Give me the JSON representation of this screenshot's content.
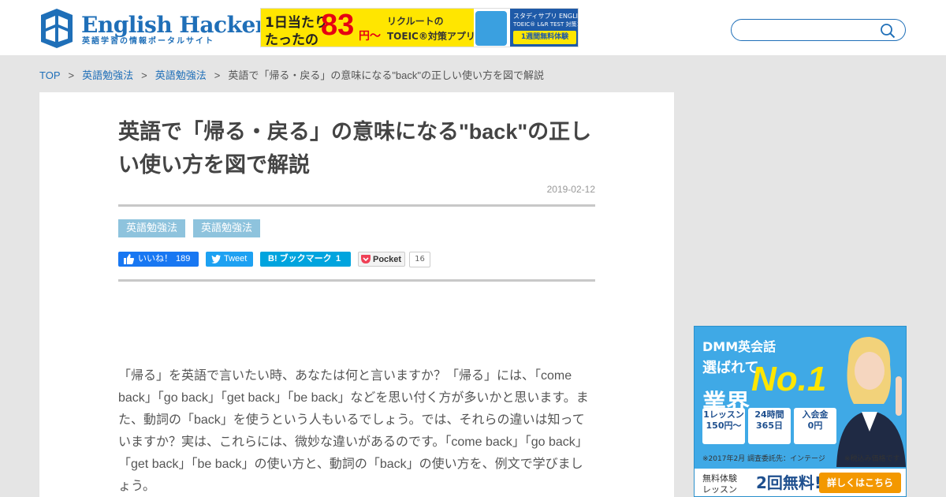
{
  "header": {
    "logo": {
      "title": "English Hacker",
      "subtitle": "英語学習の情報ポータルサイト"
    },
    "banner": {
      "line1": "1日当たり",
      "line2": "たったの",
      "price": "83",
      "yen": "円〜",
      "recruit": "リクルートの",
      "toeic": "TOEIC®対策アプリ",
      "brand": "スタディサプリ ENGLISH",
      "course": "TOEIC® L&R TEST 対策コース",
      "cta": "1週間無料体験"
    },
    "search": {
      "placeholder": ""
    }
  },
  "breadcrumb": {
    "items": [
      "TOP",
      "英語勉強法",
      "英語勉強法"
    ],
    "separator": ">",
    "current": "英語で「帰る・戻る」の意味になる\"back\"の正しい使い方を図で解説"
  },
  "article": {
    "title": "英語で「帰る・戻る」の意味になる\"back\"の正しい使い方を図で解説",
    "date": "2019-02-12",
    "tags": [
      "英語勉強法",
      "英語勉強法"
    ],
    "share": {
      "facebook_label": "いいね！",
      "facebook_count": "189",
      "twitter_label": "Tweet",
      "hatena_label": "B! ブックマーク",
      "hatena_count": "1",
      "pocket_label": "Pocket",
      "pocket_count": "16"
    },
    "body": "「帰る」を英語で言いたい時、あなたは何と言いますか？「帰る」には、「come back」「go back」「get back」「be back」などを思い付く方が多いかと思います。また、動詞の「back」を使うという人もいるでしょう。では、それらの違いは知っていますか？実は、これらには、微妙な違いがあるのです。「come back」「go back」「get back」「be back」の使い方と、動詞の「back」の使い方を、例文で学びましょう。"
  },
  "side_ad": {
    "brand": "DMM英会話",
    "sub": "選ばれて",
    "main": "業界",
    "no1": "No.1",
    "boxes": [
      {
        "l1": "1レッスン",
        "l2": "150円〜"
      },
      {
        "l1": "24時間",
        "l2": "365日"
      },
      {
        "l1": "入会金",
        "l2": "0円"
      }
    ],
    "note1": "※2017年2月 調査委託先：インテージ",
    "note2": "※税込み価格です",
    "trial": "無料体験\nレッスン",
    "free": "2回無料!",
    "cta": "詳しくはこちら"
  },
  "colors": {
    "accent": "#1f6fb8",
    "tag": "#8ec3dd",
    "background": "#e5e5e5"
  }
}
